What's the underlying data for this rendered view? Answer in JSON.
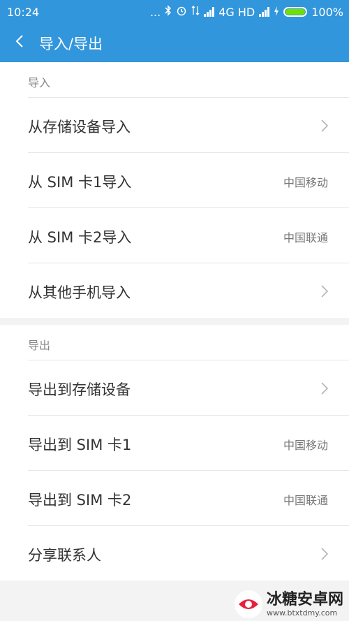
{
  "status_bar": {
    "time": "10:24",
    "dots": "...",
    "network_label": "4G HD",
    "battery_percent": "100%"
  },
  "header": {
    "title": "导入/导出"
  },
  "import_section": {
    "heading": "导入",
    "items": [
      {
        "label": "从存储设备导入",
        "value": "",
        "chevron": true
      },
      {
        "label": "从 SIM 卡1导入",
        "value": "中国移动",
        "chevron": false
      },
      {
        "label": "从 SIM 卡2导入",
        "value": "中国联通",
        "chevron": false
      },
      {
        "label": "从其他手机导入",
        "value": "",
        "chevron": true
      }
    ]
  },
  "export_section": {
    "heading": "导出",
    "items": [
      {
        "label": "导出到存储设备",
        "value": "",
        "chevron": true
      },
      {
        "label": "导出到 SIM 卡1",
        "value": "中国移动",
        "chevron": false
      },
      {
        "label": "导出到 SIM 卡2",
        "value": "中国联通",
        "chevron": false
      },
      {
        "label": "分享联系人",
        "value": "",
        "chevron": true
      }
    ]
  },
  "watermark": {
    "text": "冰糖安卓网",
    "url": "www.btxtdmy.com"
  },
  "colors": {
    "header_bg": "#3296dc",
    "battery_fill": "#6fe000"
  }
}
